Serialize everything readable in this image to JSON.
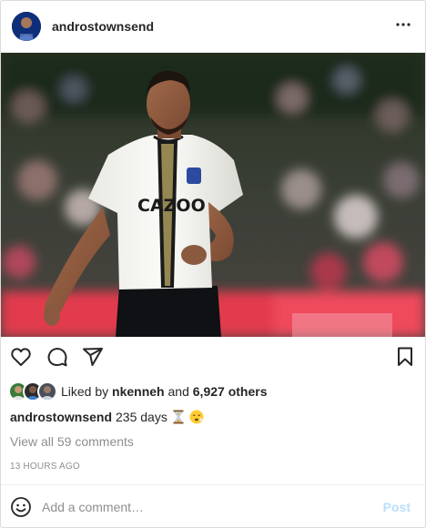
{
  "post": {
    "username": "androstownsend",
    "more_icon": "more-horizontal-icon"
  },
  "actions": {
    "like_icon": "heart-icon",
    "comment_icon": "comment-icon",
    "share_icon": "share-icon",
    "save_icon": "bookmark-icon"
  },
  "likes": {
    "prefix": "Liked by",
    "first_liker": "nkenneh",
    "connector": "and",
    "others": "6,927 others"
  },
  "caption": {
    "username": "androstownsend",
    "text": "235 days",
    "emojis": [
      "hourglass-emoji",
      "face-exhaling-emoji"
    ]
  },
  "comments": {
    "view_all": "View all 59 comments"
  },
  "timestamp": "13 HOURS AGO",
  "comment_bar": {
    "emoji_icon": "smiley-icon",
    "placeholder": "Add a comment…",
    "post_label": "Post",
    "post_color": "#b9dffc"
  }
}
